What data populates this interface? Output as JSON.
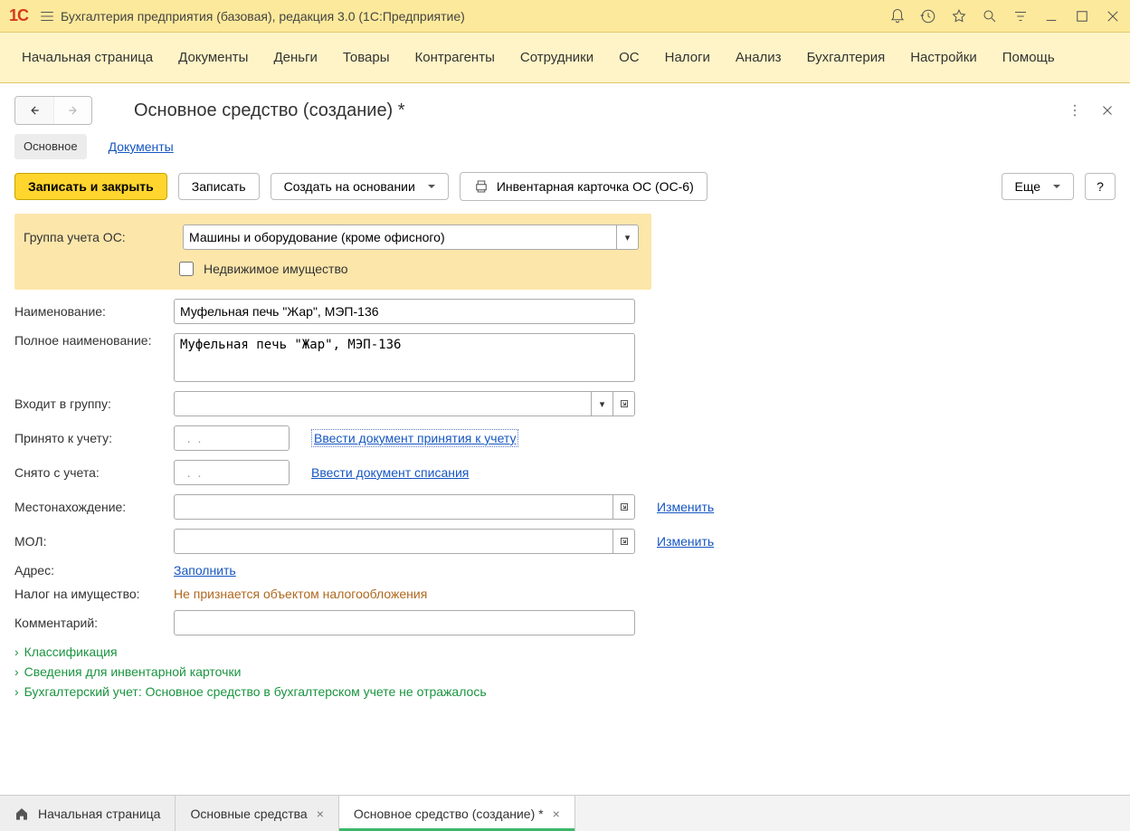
{
  "titlebar": {
    "app_title": "Бухгалтерия предприятия (базовая), редакция 3.0  (1С:Предприятие)"
  },
  "mainnav": [
    "Начальная страница",
    "Документы",
    "Деньги",
    "Товары",
    "Контрагенты",
    "Сотрудники",
    "ОС",
    "Налоги",
    "Анализ",
    "Бухгалтерия",
    "Настройки",
    "Помощь"
  ],
  "page": {
    "title": "Основное средство (создание) *"
  },
  "subtabs": {
    "main": "Основное",
    "docs": "Документы"
  },
  "toolbar": {
    "save_close": "Записать и закрыть",
    "save": "Записать",
    "create_based": "Создать на основании",
    "print_card": "Инвентарная карточка ОС (ОС-6)",
    "more": "Еще",
    "help": "?"
  },
  "form": {
    "group_label": "Группа учета ОС:",
    "group_value": "Машины и оборудование (кроме офисного)",
    "realty_label": "Недвижимое имущество",
    "name_label": "Наименование:",
    "name_value": "Муфельная печь \"Жар\", МЭП-136",
    "full_name_label": "Полное наименование:",
    "full_name_value": "Муфельная печь \"Жар\", МЭП-136",
    "in_group_label": "Входит в группу:",
    "in_group_value": "",
    "accepted_label": "Принято к учету:",
    "accepted_value": "  .  .",
    "accepted_link": "Ввести документ принятия к учету",
    "removed_label": "Снято с учета:",
    "removed_value": "  .  .",
    "removed_link": "Ввести документ списания",
    "location_label": "Местонахождение:",
    "location_value": "",
    "location_link": "Изменить",
    "mol_label": "МОЛ:",
    "mol_value": "",
    "mol_link": "Изменить",
    "address_label": "Адрес:",
    "address_link": "Заполнить",
    "tax_label": "Налог на имущество:",
    "tax_value": "Не признается объектом налогообложения",
    "comment_label": "Комментарий:",
    "comment_value": ""
  },
  "groups": {
    "g1": "Классификация",
    "g2": "Сведения для инвентарной карточки",
    "g3": "Бухгалтерский учет: Основное средство в бухгалтерском учете не отражалось"
  },
  "bottom_tabs": {
    "t1": "Начальная страница",
    "t2": "Основные средства",
    "t3": "Основное средство (создание) *"
  }
}
